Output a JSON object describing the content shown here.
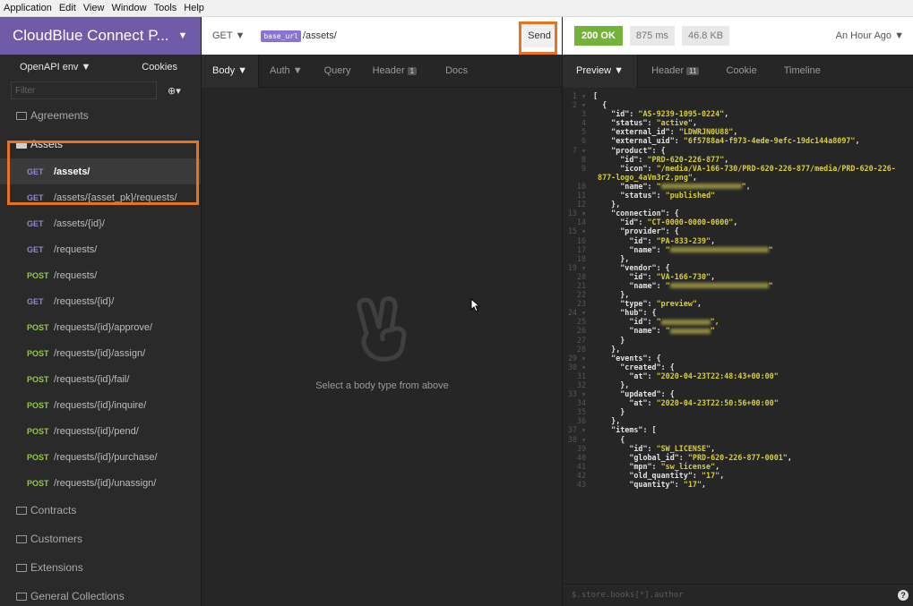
{
  "menubar": [
    "Application",
    "Edit",
    "View",
    "Window",
    "Tools",
    "Help"
  ],
  "workspace": {
    "name": "CloudBlue Connect P...",
    "caret": "▼"
  },
  "sidebar": {
    "env": "OpenAPI env ▼",
    "cookies": "Cookies",
    "filter_placeholder": "Filter",
    "add_icon": "plus-circle-icon",
    "folders_top": [
      {
        "label": "Agreements"
      }
    ],
    "assets_folder": "Assets",
    "requests": [
      {
        "method": "GET",
        "path": "/assets/"
      },
      {
        "method": "GET",
        "path": "/assets/{asset_pk}/requests/"
      },
      {
        "method": "GET",
        "path": "/assets/{id}/"
      },
      {
        "method": "GET",
        "path": "/requests/"
      },
      {
        "method": "POST",
        "path": "/requests/"
      },
      {
        "method": "GET",
        "path": "/requests/{id}/"
      },
      {
        "method": "POST",
        "path": "/requests/{id}/approve/"
      },
      {
        "method": "POST",
        "path": "/requests/{id}/assign/"
      },
      {
        "method": "POST",
        "path": "/requests/{id}/fail/"
      },
      {
        "method": "POST",
        "path": "/requests/{id}/inquire/"
      },
      {
        "method": "POST",
        "path": "/requests/{id}/pend/"
      },
      {
        "method": "POST",
        "path": "/requests/{id}/purchase/"
      },
      {
        "method": "POST",
        "path": "/requests/{id}/unassign/"
      }
    ],
    "folders_bottom": [
      {
        "label": "Contracts"
      },
      {
        "label": "Customers"
      },
      {
        "label": "Extensions"
      },
      {
        "label": "General Collections"
      }
    ]
  },
  "request": {
    "method": "GET ▼",
    "env_tag": "base_url",
    "path": "/assets/",
    "send": "Send",
    "tabs": [
      "Body ▼",
      "Auth ▼",
      "Query",
      "Header",
      "Docs"
    ],
    "header_count": "1",
    "empty_text": "Select a body type from above",
    "empty_icon": "peace-hand-icon"
  },
  "response": {
    "status": "200 OK",
    "time": "875 ms",
    "size": "46.8 KB",
    "updated": "An Hour Ago ▼",
    "tabs": [
      "Preview ▼",
      "Header",
      "Cookie",
      "Timeline"
    ],
    "header_count": "11",
    "filter_placeholder": "$.store.books[*].author",
    "lines": [
      {
        "n": "1 ▾",
        "t": "["
      },
      {
        "n": "2 ▾",
        "t": "  {"
      },
      {
        "n": "3",
        "k": "    \"id\": ",
        "s": "\"AS-9239-1095-0224\"",
        "e": ","
      },
      {
        "n": "4",
        "k": "    \"status\": ",
        "s": "\"active\"",
        "e": ","
      },
      {
        "n": "5",
        "k": "    \"external_id\": ",
        "s": "\"LDWRJN0U88\"",
        "e": ","
      },
      {
        "n": "6",
        "k": "    \"external_uid\": ",
        "s": "\"6f5788a4-f973-4ede-9efc-19dc144a8097\"",
        "e": ","
      },
      {
        "n": "7 ▾",
        "t": "    \"product\": {"
      },
      {
        "n": "8",
        "k": "      \"id\": ",
        "s": "\"PRD-620-226-877\"",
        "e": ","
      },
      {
        "n": "9",
        "k": "      \"icon\": ",
        "s": "\"/media/VA-166-730/PRD-620-226-877/media/PRD-620-226-",
        "e": ""
      },
      {
        "n": "",
        "s": "877-logo_4aVm3r2.png\"",
        "e": ","
      },
      {
        "n": "10",
        "k": "      \"name\": ",
        "s": "\"",
        "blur": 90,
        "e": "\","
      },
      {
        "n": "11",
        "k": "      \"status\": ",
        "s": "\"published\"",
        "e": ""
      },
      {
        "n": "12",
        "t": "    },"
      },
      {
        "n": "13 ▾",
        "t": "    \"connection\": {"
      },
      {
        "n": "14",
        "k": "      \"id\": ",
        "s": "\"CT-0000-0000-0000\"",
        "e": ","
      },
      {
        "n": "15 ▾",
        "t": "      \"provider\": {"
      },
      {
        "n": "16",
        "k": "        \"id\": ",
        "s": "\"PA-833-239\"",
        "e": ","
      },
      {
        "n": "17",
        "k": "        \"name\": ",
        "s": "\"",
        "blur": 110,
        "e": "\""
      },
      {
        "n": "18",
        "t": "      },"
      },
      {
        "n": "19 ▾",
        "t": "      \"vendor\": {"
      },
      {
        "n": "20",
        "k": "        \"id\": ",
        "s": "\"VA-166-730\"",
        "e": ","
      },
      {
        "n": "21",
        "k": "        \"name\": ",
        "s": "\"",
        "blur": 110,
        "e": "\""
      },
      {
        "n": "22",
        "t": "      },"
      },
      {
        "n": "23",
        "k": "      \"type\": ",
        "s": "\"preview\"",
        "e": ","
      },
      {
        "n": "24 ▾",
        "t": "      \"hub\": {"
      },
      {
        "n": "25",
        "k": "        \"id\": ",
        "s": "\"",
        "blur": 55,
        "e": "\","
      },
      {
        "n": "26",
        "k": "        \"name\": ",
        "s": "\"",
        "blur": 45,
        "e": "\""
      },
      {
        "n": "27",
        "t": "      }"
      },
      {
        "n": "28",
        "t": "    },"
      },
      {
        "n": "29 ▾",
        "t": "    \"events\": {"
      },
      {
        "n": "30 ▾",
        "t": "      \"created\": {"
      },
      {
        "n": "31",
        "k": "        \"at\": ",
        "s": "\"2020-04-23T22:48:43+00:00\"",
        "e": ""
      },
      {
        "n": "32",
        "t": "      },"
      },
      {
        "n": "33 ▾",
        "t": "      \"updated\": {"
      },
      {
        "n": "34",
        "k": "        \"at\": ",
        "s": "\"2020-04-23T22:50:56+00:00\"",
        "e": ""
      },
      {
        "n": "35",
        "t": "      }"
      },
      {
        "n": "36",
        "t": "    },"
      },
      {
        "n": "37 ▾",
        "t": "    \"items\": ["
      },
      {
        "n": "38 ▾",
        "t": "      {"
      },
      {
        "n": "39",
        "k": "        \"id\": ",
        "s": "\"SW_LICENSE\"",
        "e": ","
      },
      {
        "n": "40",
        "k": "        \"global_id\": ",
        "s": "\"PRD-620-226-877-0001\"",
        "e": ","
      },
      {
        "n": "41",
        "k": "        \"mpn\": ",
        "s": "\"sw_license\"",
        "e": ","
      },
      {
        "n": "42",
        "k": "        \"old_quantity\": ",
        "s": "\"17\"",
        "e": ","
      },
      {
        "n": "43",
        "k": "        \"quantity\": ",
        "s": "\"17\"",
        "e": ","
      }
    ]
  },
  "colors": {
    "accent": "#6f5ba8",
    "highlight": "#e8731e",
    "ok": "#75b23a",
    "string": "#d8ce3a"
  }
}
